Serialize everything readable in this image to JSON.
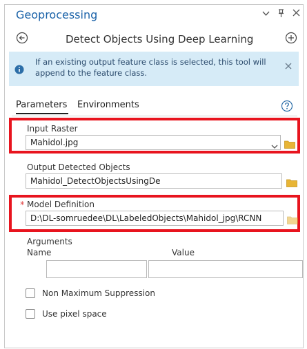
{
  "header": {
    "pane_title": "Geoprocessing",
    "tool_title": "Detect Objects Using Deep Learning"
  },
  "info_banner": {
    "message": "If an existing output feature class is selected, this tool will append to the feature class."
  },
  "tabs": {
    "parameters": "Parameters",
    "environments": "Environments"
  },
  "params": {
    "input_raster": {
      "label": "Input Raster",
      "value": "Mahidol.jpg"
    },
    "output_objects": {
      "label": "Output Detected Objects",
      "value": "Mahidol_DetectObjectsUsingDe"
    },
    "model_definition": {
      "label": "Model Definition",
      "value": "D:\\DL-somruedee\\DL\\LabeledObjects\\Mahidol_jpg\\RCNN",
      "required_marker": "*"
    },
    "arguments": {
      "label": "Arguments",
      "col_name": "Name",
      "col_value": "Value",
      "name_value": "",
      "value_value": ""
    }
  },
  "options": {
    "nms_label": "Non Maximum Suppression",
    "pixel_space_label": "Use pixel space"
  },
  "icons": {
    "window_menu": "chevron-down-icon",
    "pin": "pin-icon",
    "close": "close-icon",
    "back": "back-arrow-icon",
    "add": "add-icon",
    "info": "info-icon",
    "help": "help-icon",
    "folder": "folder-icon"
  },
  "colors": {
    "title_blue": "#1a62a8",
    "banner_bg": "#d6ebf7",
    "highlight_red": "#e8141e",
    "folder_yellow": "#e8b536"
  }
}
